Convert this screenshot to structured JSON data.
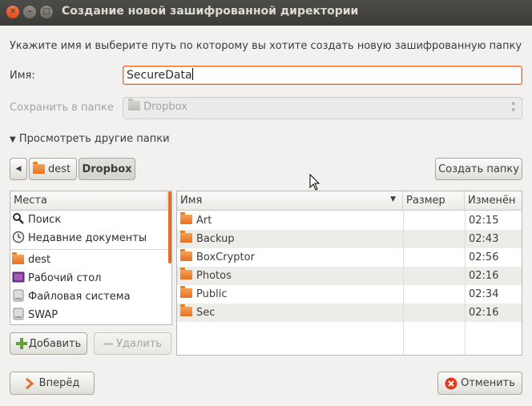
{
  "window": {
    "title": "Создание новой зашифрованной директории"
  },
  "instruction": "Укажите имя и выберите путь по которому вы хотите создать новую зашифрованную папку",
  "name_field": {
    "label": "Имя:",
    "value": "SecureData"
  },
  "save_in": {
    "label": "Сохранить в папке",
    "value": "Dropbox"
  },
  "browse_toggle": {
    "label": "Просмотреть другие папки"
  },
  "path_bar": {
    "segments": [
      "dest",
      "Dropbox"
    ]
  },
  "create_folder_label": "Создать папку",
  "places": {
    "header": "Места",
    "items": [
      {
        "label": "Поиск",
        "icon": "search-icon"
      },
      {
        "label": "Недавние документы",
        "icon": "clock-icon"
      },
      {
        "label": "dest",
        "icon": "home-folder-icon"
      },
      {
        "label": "Рабочий стол",
        "icon": "desktop-icon"
      },
      {
        "label": "Файловая система",
        "icon": "drive-icon"
      },
      {
        "label": "SWAP",
        "icon": "drive-icon"
      }
    ],
    "add_label": "Добавить",
    "remove_label": "Удалить"
  },
  "files": {
    "columns": {
      "name": "Имя",
      "size": "Размер",
      "modified": "Изменён"
    },
    "rows": [
      {
        "name": "Art",
        "size": "",
        "modified": "02:15"
      },
      {
        "name": "Backup",
        "size": "",
        "modified": "02:43"
      },
      {
        "name": "BoxCryptor",
        "size": "",
        "modified": "02:56"
      },
      {
        "name": "Photos",
        "size": "",
        "modified": "02:16"
      },
      {
        "name": "Public",
        "size": "",
        "modified": "02:34"
      },
      {
        "name": "Sec",
        "size": "",
        "modified": "02:16"
      }
    ]
  },
  "forward_label": "Вперёд",
  "cancel_label": "Отменить",
  "colors": {
    "accent": "#e86b2a",
    "titlebar": "#3c3b37",
    "close": "#df4a16"
  }
}
